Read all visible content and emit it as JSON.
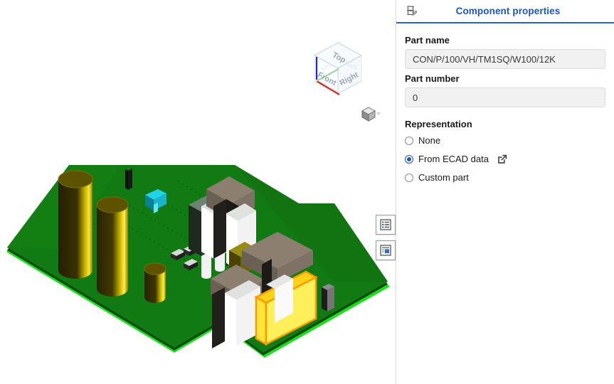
{
  "viewport": {
    "name": "3d-model-viewport",
    "model": "printed-circuit-board-assembly",
    "board_color": "#127a12",
    "board_edge_highlight": "#19e019",
    "selected_part_color": "#ffe43a",
    "selected_part_outline": "#ff9900",
    "view_cube": {
      "faces": [
        "Top",
        "Front",
        "Right"
      ],
      "axis_colors": {
        "z": "#2222dd",
        "x": "#dd2222",
        "y": "#8fd08f"
      }
    },
    "home_cube_tooltip": "Isometric view",
    "tools": [
      {
        "name": "show-structure-panel",
        "icon": "list-panel-icon"
      },
      {
        "name": "show-properties-panel",
        "icon": "detail-panel-icon"
      }
    ]
  },
  "panel": {
    "header": {
      "icon": "edit-note-icon",
      "title": "Component properties",
      "accent": "#1a56c4",
      "underline": "#2b5fb8"
    },
    "part_name": {
      "label": "Part name",
      "value": "CON/P/100/VH/TM1SQ/W100/12K",
      "placeholder": "Part name"
    },
    "part_number": {
      "label": "Part number",
      "value": "0",
      "placeholder": "Part number"
    },
    "representation": {
      "label": "Representation",
      "selected": "from-ecad-data",
      "options": [
        {
          "id": "none",
          "label": "None",
          "selected": false,
          "link": false
        },
        {
          "id": "from-ecad-data",
          "label": "From ECAD data",
          "selected": true,
          "link": true
        },
        {
          "id": "custom-part",
          "label": "Custom part",
          "selected": false,
          "link": false
        }
      ],
      "link_icon": "external-link-icon"
    }
  }
}
